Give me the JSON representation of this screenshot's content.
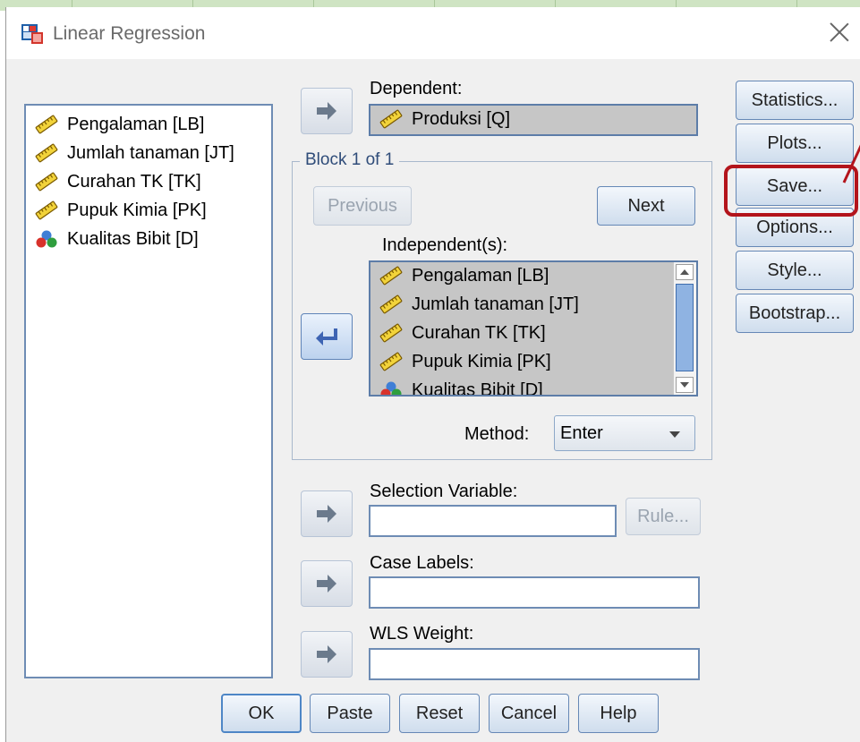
{
  "window": {
    "title": "Linear Regression"
  },
  "variables": [
    {
      "label": "Pengalaman [LB]",
      "icon": "scale-ruler-icon"
    },
    {
      "label": "Jumlah tanaman [JT]",
      "icon": "scale-ruler-icon"
    },
    {
      "label": "Curahan TK [TK]",
      "icon": "scale-ruler-icon"
    },
    {
      "label": "Pupuk Kimia [PK]",
      "icon": "scale-ruler-icon"
    },
    {
      "label": "Kualitas Bibit [D]",
      "icon": "nominal-balls-icon"
    }
  ],
  "dependent": {
    "label": "Dependent:",
    "value": "Produksi [Q]"
  },
  "block": {
    "title": "Block 1 of 1",
    "previous_label": "Previous",
    "next_label": "Next",
    "independents_label": "Independent(s):",
    "independents": [
      "Pengalaman [LB]",
      "Jumlah tanaman [JT]",
      "Curahan TK [TK]",
      "Pupuk Kimia [PK]",
      "Kualitas Bibit [D]"
    ],
    "method_label": "Method:",
    "method_value": "Enter"
  },
  "selection": {
    "label": "Selection Variable:",
    "value": "",
    "rule_label": "Rule..."
  },
  "case_labels": {
    "label": "Case Labels:",
    "value": ""
  },
  "wls": {
    "label": "WLS Weight:",
    "value": ""
  },
  "side_buttons": {
    "statistics": "Statistics...",
    "plots": "Plots...",
    "save": "Save...",
    "options": "Options...",
    "style": "Style...",
    "bootstrap": "Bootstrap..."
  },
  "footer": {
    "ok": "OK",
    "paste": "Paste",
    "reset": "Reset",
    "cancel": "Cancel",
    "help": "Help"
  },
  "colors": {
    "highlight": "#b3141b",
    "field_border": "#6e8cb4",
    "group_title": "#2f4c79"
  }
}
